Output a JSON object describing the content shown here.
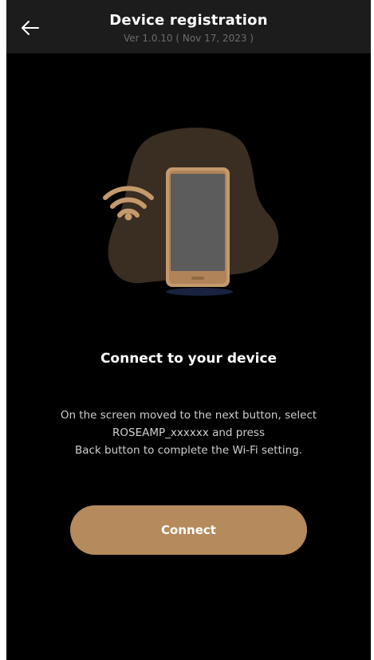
{
  "header": {
    "title": "Device registration",
    "subtitle": "Ver 1.0.10 ( Nov 17, 2023 )",
    "back_icon": "arrow-left-icon"
  },
  "illustration": {
    "icons": [
      "wifi-icon",
      "smartphone-icon"
    ],
    "colors": {
      "blob": "#3a2d22",
      "phone_body": "#c49a6c",
      "phone_screen": "#5c5c5c",
      "wifi": "#c49a6c"
    }
  },
  "main": {
    "heading": "Connect to your device",
    "description_lines": [
      "On the screen moved to the next button, select",
      "ROSEAMP_xxxxxx and press",
      "Back button to complete the Wi-Fi setting."
    ]
  },
  "connect_button": {
    "label": "Connect",
    "color": "#b58a5c"
  }
}
